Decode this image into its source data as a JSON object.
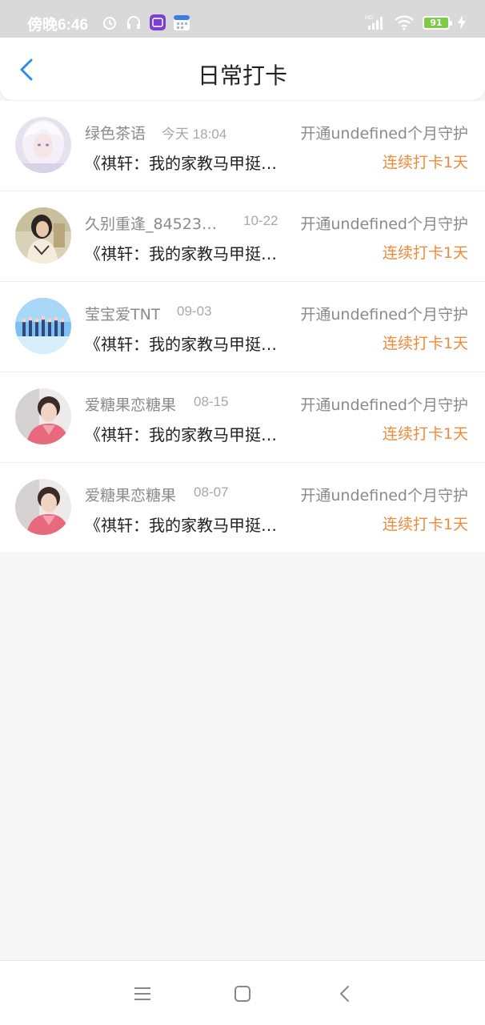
{
  "status_bar": {
    "time": "傍晚6:46",
    "battery": "91",
    "icons": [
      "alarm-icon",
      "headset-icon",
      "app-icon",
      "calendar-icon",
      "hd-signal-icon",
      "wifi-icon",
      "battery-icon",
      "charging-icon"
    ]
  },
  "header": {
    "title": "日常打卡",
    "back_icon": "chevron-left-icon"
  },
  "records": [
    {
      "name": "绿色茶语",
      "date": "今天 18:04",
      "guard": "开通undefined个月守护",
      "book": "《祺轩：我的家教马甲挺…",
      "streak": "连续打卡1天",
      "avatar": "avatar-white-hair"
    },
    {
      "name": "久别重逢_84523…",
      "date": "10-22",
      "guard": "开通undefined个月守护",
      "book": "《祺轩：我的家教马甲挺…",
      "streak": "连续打卡1天",
      "avatar": "avatar-dark-hair"
    },
    {
      "name": "莹宝爱TNT",
      "date": "09-03",
      "guard": "开通undefined个月守护",
      "book": "《祺轩：我的家教马甲挺…",
      "streak": "连续打卡1天",
      "avatar": "avatar-group-sky"
    },
    {
      "name": "爱糖果恋糖果",
      "date": "08-15",
      "guard": "开通undefined个月守护",
      "book": "《祺轩：我的家教马甲挺…",
      "streak": "连续打卡1天",
      "avatar": "avatar-pink-jacket"
    },
    {
      "name": "爱糖果恋糖果",
      "date": "08-07",
      "guard": "开通undefined个月守护",
      "book": "《祺轩：我的家教马甲挺…",
      "streak": "连续打卡1天",
      "avatar": "avatar-pink-jacket"
    }
  ],
  "system_nav": [
    "menu-icon",
    "home-icon",
    "back-icon"
  ],
  "colors": {
    "accent": "#2b8fe8",
    "streak": "#f28a3a",
    "muted_text": "#8a8a8a",
    "background": "#f7f6f7"
  }
}
